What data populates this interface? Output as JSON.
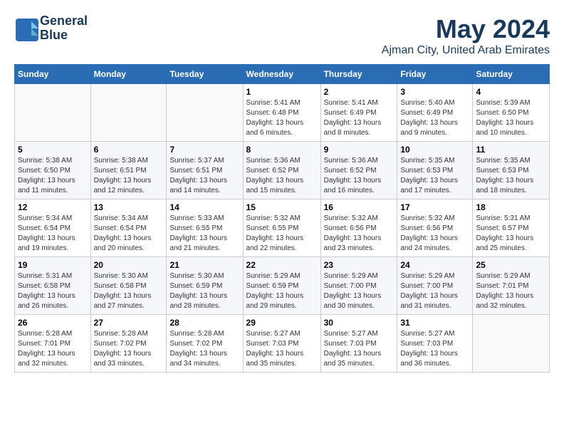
{
  "logo": {
    "line1": "General",
    "line2": "Blue"
  },
  "title": "May 2024",
  "subtitle": "Ajman City, United Arab Emirates",
  "headers": [
    "Sunday",
    "Monday",
    "Tuesday",
    "Wednesday",
    "Thursday",
    "Friday",
    "Saturday"
  ],
  "weeks": [
    [
      {
        "day": "",
        "sunrise": "",
        "sunset": "",
        "daylight": ""
      },
      {
        "day": "",
        "sunrise": "",
        "sunset": "",
        "daylight": ""
      },
      {
        "day": "",
        "sunrise": "",
        "sunset": "",
        "daylight": ""
      },
      {
        "day": "1",
        "sunrise": "Sunrise: 5:41 AM",
        "sunset": "Sunset: 6:48 PM",
        "daylight": "Daylight: 13 hours and 6 minutes."
      },
      {
        "day": "2",
        "sunrise": "Sunrise: 5:41 AM",
        "sunset": "Sunset: 6:49 PM",
        "daylight": "Daylight: 13 hours and 8 minutes."
      },
      {
        "day": "3",
        "sunrise": "Sunrise: 5:40 AM",
        "sunset": "Sunset: 6:49 PM",
        "daylight": "Daylight: 13 hours and 9 minutes."
      },
      {
        "day": "4",
        "sunrise": "Sunrise: 5:39 AM",
        "sunset": "Sunset: 6:50 PM",
        "daylight": "Daylight: 13 hours and 10 minutes."
      }
    ],
    [
      {
        "day": "5",
        "sunrise": "Sunrise: 5:38 AM",
        "sunset": "Sunset: 6:50 PM",
        "daylight": "Daylight: 13 hours and 11 minutes."
      },
      {
        "day": "6",
        "sunrise": "Sunrise: 5:38 AM",
        "sunset": "Sunset: 6:51 PM",
        "daylight": "Daylight: 13 hours and 12 minutes."
      },
      {
        "day": "7",
        "sunrise": "Sunrise: 5:37 AM",
        "sunset": "Sunset: 6:51 PM",
        "daylight": "Daylight: 13 hours and 14 minutes."
      },
      {
        "day": "8",
        "sunrise": "Sunrise: 5:36 AM",
        "sunset": "Sunset: 6:52 PM",
        "daylight": "Daylight: 13 hours and 15 minutes."
      },
      {
        "day": "9",
        "sunrise": "Sunrise: 5:36 AM",
        "sunset": "Sunset: 6:52 PM",
        "daylight": "Daylight: 13 hours and 16 minutes."
      },
      {
        "day": "10",
        "sunrise": "Sunrise: 5:35 AM",
        "sunset": "Sunset: 6:53 PM",
        "daylight": "Daylight: 13 hours and 17 minutes."
      },
      {
        "day": "11",
        "sunrise": "Sunrise: 5:35 AM",
        "sunset": "Sunset: 6:53 PM",
        "daylight": "Daylight: 13 hours and 18 minutes."
      }
    ],
    [
      {
        "day": "12",
        "sunrise": "Sunrise: 5:34 AM",
        "sunset": "Sunset: 6:54 PM",
        "daylight": "Daylight: 13 hours and 19 minutes."
      },
      {
        "day": "13",
        "sunrise": "Sunrise: 5:34 AM",
        "sunset": "Sunset: 6:54 PM",
        "daylight": "Daylight: 13 hours and 20 minutes."
      },
      {
        "day": "14",
        "sunrise": "Sunrise: 5:33 AM",
        "sunset": "Sunset: 6:55 PM",
        "daylight": "Daylight: 13 hours and 21 minutes."
      },
      {
        "day": "15",
        "sunrise": "Sunrise: 5:32 AM",
        "sunset": "Sunset: 6:55 PM",
        "daylight": "Daylight: 13 hours and 22 minutes."
      },
      {
        "day": "16",
        "sunrise": "Sunrise: 5:32 AM",
        "sunset": "Sunset: 6:56 PM",
        "daylight": "Daylight: 13 hours and 23 minutes."
      },
      {
        "day": "17",
        "sunrise": "Sunrise: 5:32 AM",
        "sunset": "Sunset: 6:56 PM",
        "daylight": "Daylight: 13 hours and 24 minutes."
      },
      {
        "day": "18",
        "sunrise": "Sunrise: 5:31 AM",
        "sunset": "Sunset: 6:57 PM",
        "daylight": "Daylight: 13 hours and 25 minutes."
      }
    ],
    [
      {
        "day": "19",
        "sunrise": "Sunrise: 5:31 AM",
        "sunset": "Sunset: 6:58 PM",
        "daylight": "Daylight: 13 hours and 26 minutes."
      },
      {
        "day": "20",
        "sunrise": "Sunrise: 5:30 AM",
        "sunset": "Sunset: 6:58 PM",
        "daylight": "Daylight: 13 hours and 27 minutes."
      },
      {
        "day": "21",
        "sunrise": "Sunrise: 5:30 AM",
        "sunset": "Sunset: 6:59 PM",
        "daylight": "Daylight: 13 hours and 28 minutes."
      },
      {
        "day": "22",
        "sunrise": "Sunrise: 5:29 AM",
        "sunset": "Sunset: 6:59 PM",
        "daylight": "Daylight: 13 hours and 29 minutes."
      },
      {
        "day": "23",
        "sunrise": "Sunrise: 5:29 AM",
        "sunset": "Sunset: 7:00 PM",
        "daylight": "Daylight: 13 hours and 30 minutes."
      },
      {
        "day": "24",
        "sunrise": "Sunrise: 5:29 AM",
        "sunset": "Sunset: 7:00 PM",
        "daylight": "Daylight: 13 hours and 31 minutes."
      },
      {
        "day": "25",
        "sunrise": "Sunrise: 5:29 AM",
        "sunset": "Sunset: 7:01 PM",
        "daylight": "Daylight: 13 hours and 32 minutes."
      }
    ],
    [
      {
        "day": "26",
        "sunrise": "Sunrise: 5:28 AM",
        "sunset": "Sunset: 7:01 PM",
        "daylight": "Daylight: 13 hours and 32 minutes."
      },
      {
        "day": "27",
        "sunrise": "Sunrise: 5:28 AM",
        "sunset": "Sunset: 7:02 PM",
        "daylight": "Daylight: 13 hours and 33 minutes."
      },
      {
        "day": "28",
        "sunrise": "Sunrise: 5:28 AM",
        "sunset": "Sunset: 7:02 PM",
        "daylight": "Daylight: 13 hours and 34 minutes."
      },
      {
        "day": "29",
        "sunrise": "Sunrise: 5:27 AM",
        "sunset": "Sunset: 7:03 PM",
        "daylight": "Daylight: 13 hours and 35 minutes."
      },
      {
        "day": "30",
        "sunrise": "Sunrise: 5:27 AM",
        "sunset": "Sunset: 7:03 PM",
        "daylight": "Daylight: 13 hours and 35 minutes."
      },
      {
        "day": "31",
        "sunrise": "Sunrise: 5:27 AM",
        "sunset": "Sunset: 7:03 PM",
        "daylight": "Daylight: 13 hours and 36 minutes."
      },
      {
        "day": "",
        "sunrise": "",
        "sunset": "",
        "daylight": ""
      }
    ]
  ]
}
